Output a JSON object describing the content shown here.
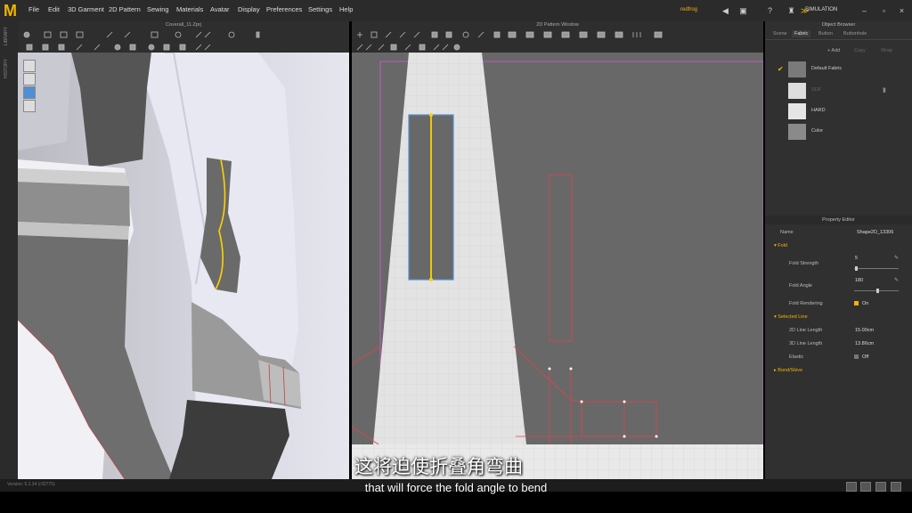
{
  "app": {
    "logo": "M",
    "menu": [
      "File",
      "Edit",
      "3D Garment",
      "2D Pattern",
      "Sewing",
      "Materials",
      "Avatar",
      "Display",
      "Preferences",
      "Settings",
      "Help"
    ],
    "user": "redfrog",
    "mode": "SIMULATION"
  },
  "window3d": {
    "title": "Coverall_11.Zprj"
  },
  "window2d": {
    "title": "2D Pattern Window"
  },
  "sidebar": {
    "labels": [
      "LIBRARY",
      "HISTORY"
    ]
  },
  "object_browser": {
    "title": "Object Browser",
    "tabs": [
      "Scene",
      "Fabric",
      "Button",
      "Buttonhole"
    ],
    "active_tab": "Fabric",
    "actions": [
      "+ Add",
      "Copy",
      "Wrap"
    ],
    "fabrics": [
      {
        "name": "Default Fabric",
        "checked": true
      },
      {
        "name": "SOF",
        "checked": false
      },
      {
        "name": "HARD",
        "checked": false
      },
      {
        "name": "Color",
        "checked": false
      }
    ]
  },
  "property_editor": {
    "title": "Property Editor",
    "name_label": "Name",
    "name_value": "Shape2D_13306",
    "fold_section": "Fold",
    "fold_strength_label": "Fold Strength",
    "fold_strength_value": "5",
    "fold_angle_label": "Fold Angle",
    "fold_angle_value": "180",
    "fold_rendering_label": "Fold Rendering",
    "fold_rendering_value": "On",
    "selected_line_section": "Selected Line",
    "line2d_label": "2D Line Length",
    "line2d_value": "15.00cm",
    "line3d_label": "3D Line Length",
    "line3d_value": "13.86cm",
    "elastic_label": "Elastic",
    "elastic_value": "Off",
    "bond_section": "Bond/Skive"
  },
  "status": {
    "version": "Version: 5.1.34 (r32775)"
  },
  "subtitles": {
    "chinese": "这将迫使折叠角弯曲",
    "english": "that will force the fold angle to bend"
  },
  "colors": {
    "accent": "#f0b400",
    "selected_line": "#ffd200",
    "seam": "#e0434b",
    "panel": "#303030"
  }
}
